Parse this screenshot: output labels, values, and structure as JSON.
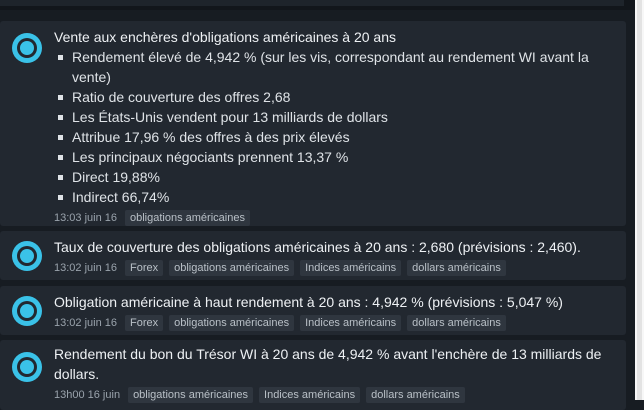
{
  "items": [
    {
      "headline": "Vente aux enchères d'obligations américaines à 20 ans",
      "points": [
        "Rendement élevé de 4,942 % (sur les vis, correspondant au rendement WI avant la vente)",
        "Ratio de couverture des offres 2,68",
        "Les États-Unis vendent pour 13 milliards de dollars",
        "Attribue 17,96 % des offres à des prix élevés",
        "Les principaux négociants prennent 13,37 %",
        "Direct 19,88%",
        "Indirect 66,74%"
      ],
      "time": "13:03 juin 16",
      "tags": [
        "obligations américaines"
      ]
    },
    {
      "headline": "Taux de couverture des obligations américaines à 20 ans : 2,680 (prévisions : 2,460).",
      "time": "13:02 juin 16",
      "tags": [
        "Forex",
        "obligations américaines",
        "Indices américains",
        "dollars américains"
      ]
    },
    {
      "headline": "Obligation américaine à haut rendement à 20 ans : 4,942 % (prévisions : 5,047 %)",
      "time": "13:02 juin 16",
      "tags": [
        "Forex",
        "obligations américaines",
        "Indices américains",
        "dollars américains"
      ]
    },
    {
      "headline": "Rendement du bon du Trésor WI à 20 ans de 4,942 % avant l'enchère de 13 milliards de dollars.",
      "time": "13h00 16 juin",
      "tags": [
        "obligations américaines",
        "Indices américains",
        "dollars américains"
      ]
    }
  ],
  "colors": {
    "accent": "#3ac2e8",
    "background": "#171c22",
    "card": "#222830"
  }
}
